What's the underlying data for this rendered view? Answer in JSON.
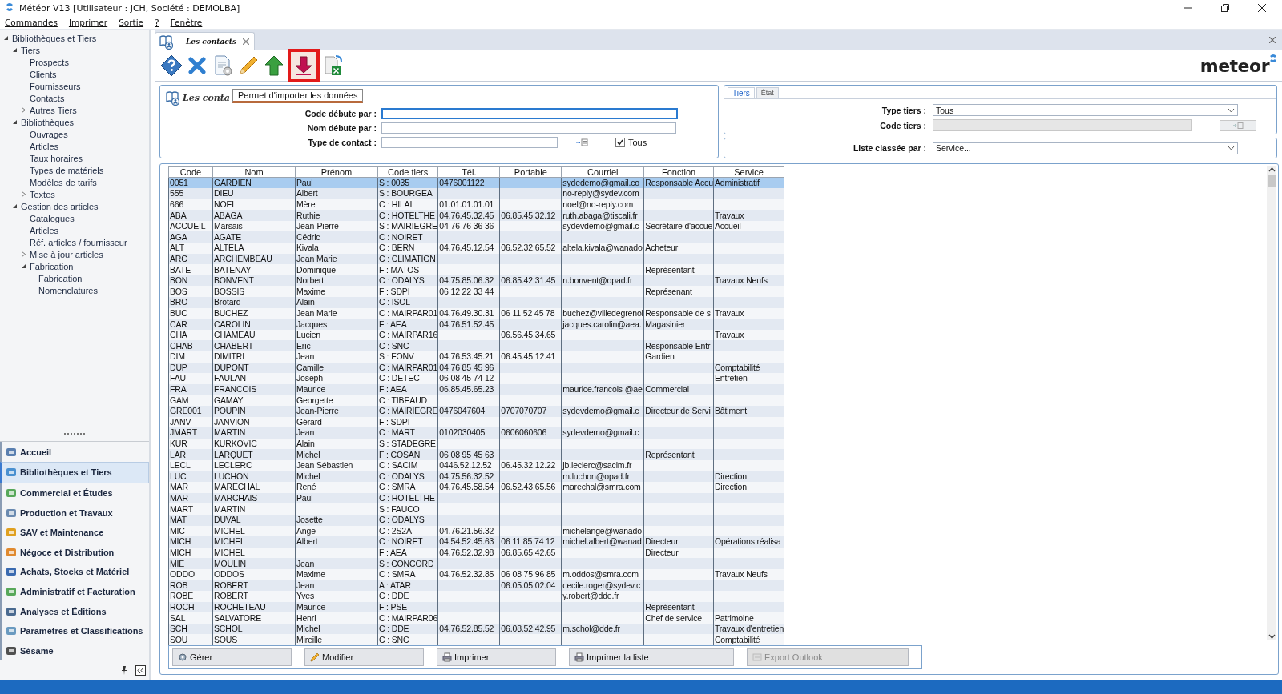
{
  "window": {
    "title": "Météor V13 [Utilisateur : JCH, Société : DEMOLBA]"
  },
  "menu": [
    "Commandes",
    "Imprimer",
    "Sortie",
    "?",
    "Fenêtre"
  ],
  "sidebar": {
    "tree": [
      {
        "label": "Bibliothèques et Tiers",
        "expanded": true,
        "children": [
          {
            "label": "Tiers",
            "expanded": true,
            "children": [
              {
                "label": "Prospects"
              },
              {
                "label": "Clients"
              },
              {
                "label": "Fournisseurs"
              },
              {
                "label": "Contacts"
              },
              {
                "label": "Autres Tiers",
                "expanded": false
              }
            ]
          },
          {
            "label": "Bibliothèques",
            "expanded": true,
            "children": [
              {
                "label": "Ouvrages"
              },
              {
                "label": "Articles"
              },
              {
                "label": "Taux horaires"
              },
              {
                "label": "Types de matériels"
              },
              {
                "label": "Modèles de tarifs"
              },
              {
                "label": "Textes",
                "expanded": false
              }
            ]
          },
          {
            "label": "Gestion des articles",
            "expanded": true,
            "children": [
              {
                "label": "Catalogues"
              },
              {
                "label": "Articles"
              },
              {
                "label": "Réf. articles / fournisseur"
              },
              {
                "label": "Mise à jour articles",
                "expanded": false
              },
              {
                "label": "Fabrication",
                "expanded": true,
                "children": [
                  {
                    "label": "Fabrication"
                  },
                  {
                    "label": "Nomenclatures"
                  }
                ]
              }
            ]
          }
        ]
      }
    ],
    "modules": [
      {
        "label": "Accueil",
        "selected": false,
        "color": "#5a7fb0"
      },
      {
        "label": "Bibliothèques et Tiers",
        "selected": true,
        "color": "#4a90d0"
      },
      {
        "label": "Commercial et Études",
        "selected": false,
        "color": "#58a85a"
      },
      {
        "label": "Production et Travaux",
        "selected": false,
        "color": "#6a8ab0"
      },
      {
        "label": "SAV et Maintenance",
        "selected": false,
        "color": "#e0a020"
      },
      {
        "label": "Négoce et Distribution",
        "selected": false,
        "color": "#e08a30"
      },
      {
        "label": "Achats, Stocks et Matériel",
        "selected": false,
        "color": "#3a6ab0"
      },
      {
        "label": "Administratif et Facturation",
        "selected": false,
        "color": "#58a85a"
      },
      {
        "label": "Analyses et Éditions",
        "selected": false,
        "color": "#4a6a90"
      },
      {
        "label": "Paramètres et Classifications",
        "selected": false,
        "color": "#6a9ac0"
      },
      {
        "label": "Sésame",
        "selected": false,
        "color": "#505050"
      }
    ]
  },
  "tab": {
    "title": "Les contacts"
  },
  "toolbar": {
    "buttons": [
      {
        "kind": "help",
        "highlighted": false
      },
      {
        "kind": "delete",
        "highlighted": false
      },
      {
        "kind": "settings",
        "highlighted": false
      },
      {
        "kind": "edit",
        "highlighted": false
      },
      {
        "kind": "export",
        "highlighted": false
      },
      {
        "kind": "import",
        "highlighted": true
      },
      {
        "kind": "excel",
        "highlighted": false
      }
    ],
    "tooltip": "Permet d'importer les données"
  },
  "brand": "meteor",
  "filter": {
    "title": "Les conta",
    "fields": [
      {
        "label": "Code débute par :",
        "kind": "text",
        "focused": true
      },
      {
        "label": "Nom débute par :",
        "kind": "text",
        "focused": false
      },
      {
        "label": "Type de contact :",
        "kind": "picker",
        "focused": false,
        "checkbox": {
          "label": "Tous",
          "checked": true
        }
      }
    ]
  },
  "tiers_panel": {
    "tabs": [
      {
        "label": "Tiers",
        "selected": true
      },
      {
        "label": "État",
        "selected": false
      }
    ],
    "fields": [
      {
        "label": "Type tiers :",
        "kind": "select",
        "value": "Tous"
      },
      {
        "label": "Code tiers :",
        "kind": "lookup",
        "disabled": true
      }
    ]
  },
  "sort": {
    "label": "Liste classée par :",
    "value": "Service..."
  },
  "table": {
    "columns": [
      "Code",
      "Nom",
      "Prénom",
      "Code tiers",
      "Tél.",
      "Portable",
      "Courriel",
      "Fonction",
      "Service"
    ],
    "rows": [
      {
        "selected": true,
        "cells": {
          "code": "0051",
          "nom": "GARDIEN",
          "prenom": "Paul",
          "tiers": "S : 0035",
          "tel": "0476001122",
          "courriel": "sydedemo@gmail.co",
          "fonction": "Responsable Accu",
          "service": "Administratif"
        }
      },
      {
        "selected": false,
        "cells": {
          "code": "555",
          "nom": "DIEU",
          "prenom": "Albert",
          "tiers": "S : BOURGEA",
          "courriel": "no-reply@sydev.com"
        }
      },
      {
        "selected": false,
        "cells": {
          "code": "666",
          "nom": "NOEL",
          "prenom": "Mère",
          "tiers": "C : HILAI",
          "tel": "01.01.01.01.01",
          "courriel": "noel@no-reply.com"
        }
      },
      {
        "selected": false,
        "cells": {
          "code": "ABA",
          "nom": "ABAGA",
          "prenom": "Ruthie",
          "tiers": "C : HOTELTHE",
          "tel": "04.76.45.32.45",
          "portable": "06.85.45.32.12",
          "courriel": "ruth.abaga@tiscali.fr",
          "service": "Travaux"
        }
      },
      {
        "selected": false,
        "cells": {
          "code": "ACCUEIL",
          "nom": "Marsais",
          "prenom": "Jean-Pierre",
          "tiers": "S : MAIRIEGRE",
          "tel": "04 76 76 36 36",
          "courriel": "sydevdemo@gmail.c",
          "fonction": "Secrétaire d'accue",
          "service": "Accueil"
        }
      },
      {
        "selected": false,
        "cells": {
          "code": "AGA",
          "nom": "AGATE",
          "prenom": "Cédric",
          "tiers": "C : NOIRET"
        }
      },
      {
        "selected": false,
        "cells": {
          "code": "ALT",
          "nom": "ALTELA",
          "prenom": "Kivala",
          "tiers": "C : BERN",
          "tel": "04.76.45.12.54",
          "portable": "06.52.32.65.52",
          "courriel": "altela.kivala@wanado",
          "fonction": "Acheteur"
        }
      },
      {
        "selected": false,
        "cells": {
          "code": "ARC",
          "nom": "ARCHEMBEAU",
          "prenom": "Jean Marie",
          "tiers": "C : CLIMATIGN"
        }
      },
      {
        "selected": false,
        "cells": {
          "code": "BATE",
          "nom": "BATENAY",
          "prenom": "Dominique",
          "tiers": "F : MATOS",
          "fonction": "Représentant"
        }
      },
      {
        "selected": false,
        "cells": {
          "code": "BON",
          "nom": "BONVENT",
          "prenom": "Norbert",
          "tiers": "C : ODALYS",
          "tel": "04.75.85.06.32",
          "portable": "06.85.42.31.45",
          "courriel": "n.bonvent@opad.fr",
          "service": "Travaux Neufs"
        }
      },
      {
        "selected": false,
        "cells": {
          "code": "BOS",
          "nom": "BOSSIS",
          "prenom": "Maxime",
          "tiers": "F : SDPI",
          "tel": "06 12 22 33 44",
          "fonction": "Représenant"
        }
      },
      {
        "selected": false,
        "cells": {
          "code": "BRO",
          "nom": "Brotard",
          "prenom": "Alain",
          "tiers": "C : ISOL"
        }
      },
      {
        "selected": false,
        "cells": {
          "code": "BUC",
          "nom": "BUCHEZ",
          "prenom": "Jean Marie",
          "tiers": "C : MAIRPAR01",
          "tel": "04.76.49.30.31",
          "portable": "06 11 52 45 78",
          "courriel": "buchez@villedegrenol",
          "fonction": "Responsable de s",
          "service": "Travaux"
        }
      },
      {
        "selected": false,
        "cells": {
          "code": "CAR",
          "nom": "CAROLIN",
          "prenom": "Jacques",
          "tiers": "F : AEA",
          "tel": "04.76.51.52.45",
          "courriel": "jacques.carolin@aea.",
          "fonction": "Magasinier"
        }
      },
      {
        "selected": false,
        "cells": {
          "code": "CHA",
          "nom": "CHAMEAU",
          "prenom": "Lucien",
          "tiers": "C : MAIRPAR16",
          "portable": "06.56.45.34.65",
          "service": "Travaux"
        }
      },
      {
        "selected": false,
        "cells": {
          "code": "CHAB",
          "nom": "CHABERT",
          "prenom": "Eric",
          "tiers": "C : SNC",
          "fonction": "Responsable Entr"
        }
      },
      {
        "selected": false,
        "cells": {
          "code": "DIM",
          "nom": "DIMITRI",
          "prenom": "Jean",
          "tiers": "S : FONV",
          "tel": "04.76.53.45.21",
          "portable": "06.45.45.12.41",
          "fonction": "Gardien"
        }
      },
      {
        "selected": false,
        "cells": {
          "code": "DUP",
          "nom": "DUPONT",
          "prenom": "Camille",
          "tiers": "C : MAIRPAR01",
          "tel": "04 76 85 45 96",
          "service": "Comptabilité"
        }
      },
      {
        "selected": false,
        "cells": {
          "code": "FAU",
          "nom": "FAULAN",
          "prenom": "Joseph",
          "tiers": "C : DETEC",
          "tel": "06 08 45 74 12",
          "service": "Entretien"
        }
      },
      {
        "selected": false,
        "cells": {
          "code": "FRA",
          "nom": "FRANCOIS",
          "prenom": "Maurice",
          "tiers": "F : AEA",
          "tel": "06.85.45.65.23",
          "courriel": "maurice.francois @ae",
          "fonction": "Commercial"
        }
      },
      {
        "selected": false,
        "cells": {
          "code": "GAM",
          "nom": "GAMAY",
          "prenom": "Georgette",
          "tiers": "C : TIBEAUD"
        }
      },
      {
        "selected": false,
        "cells": {
          "code": "GRE001",
          "nom": "POUPIN",
          "prenom": "Jean-Pierre",
          "tiers": "C : MAIRIEGRE",
          "tel": "0476047604",
          "portable": "0707070707",
          "courriel": "sydevdemo@gmail.c",
          "fonction": "Directeur de Servi",
          "service": "Bâtiment"
        }
      },
      {
        "selected": false,
        "cells": {
          "code": "JANV",
          "nom": "JANVION",
          "prenom": "Gérard",
          "tiers": "F : SDPI"
        }
      },
      {
        "selected": false,
        "cells": {
          "code": "JMART",
          "nom": "MARTIN",
          "prenom": "Jean",
          "tiers": "C : MART",
          "tel": "0102030405",
          "portable": "0606060606",
          "courriel": "sydevdemo@gmail.c"
        }
      },
      {
        "selected": false,
        "cells": {
          "code": "KUR",
          "nom": "KURKOVIC",
          "prenom": "Alain",
          "tiers": "S : STADEGRE"
        }
      },
      {
        "selected": false,
        "cells": {
          "code": "LAR",
          "nom": "LARQUET",
          "prenom": "Michel",
          "tiers": "F : COSAN",
          "tel": "06 08 95 45 63",
          "fonction": "Représentant"
        }
      },
      {
        "selected": false,
        "cells": {
          "code": "LECL",
          "nom": "LECLERC",
          "prenom": "Jean Sébastien",
          "tiers": "C : SACIM",
          "tel": "0446.52.12.52",
          "portable": "06.45.32.12.22",
          "courriel": "jb.leclerc@sacim.fr"
        }
      },
      {
        "selected": false,
        "cells": {
          "code": "LUC",
          "nom": "LUCHON",
          "prenom": "Michel",
          "tiers": "C : ODALYS",
          "tel": "04.75.56.32.52",
          "courriel": "m.luchon@opad.fr",
          "service": "Direction"
        }
      },
      {
        "selected": false,
        "cells": {
          "code": "MAR",
          "nom": "MARECHAL",
          "prenom": "René",
          "tiers": "C : SMRA",
          "tel": "04.76.45.58.54",
          "portable": "06.52.43.65.56",
          "courriel": "marechal@smra.com",
          "service": "Direction"
        }
      },
      {
        "selected": false,
        "cells": {
          "code": "MAR",
          "nom": "MARCHAIS",
          "prenom": "Paul",
          "tiers": "C : HOTELTHE"
        }
      },
      {
        "selected": false,
        "cells": {
          "code": "MART",
          "nom": "MARTIN",
          "tiers": "S : FAUCO"
        }
      },
      {
        "selected": false,
        "cells": {
          "code": "MAT",
          "nom": "DUVAL",
          "prenom": "Josette",
          "tiers": "C : ODALYS"
        }
      },
      {
        "selected": false,
        "cells": {
          "code": "MIC",
          "nom": "MICHEL",
          "prenom": "Ange",
          "tiers": "C : 2S2A",
          "tel": "04.76.21.56.32",
          "courriel": "michelange@wanado"
        }
      },
      {
        "selected": false,
        "cells": {
          "code": "MICH",
          "nom": "MICHEL",
          "prenom": "Albert",
          "tiers": "C : NOIRET",
          "tel": "04.54.52.45.63",
          "portable": "06 11 85 74 12",
          "courriel": "michel.albert@wanad",
          "fonction": "Directeur",
          "service": "Opérations réalisa"
        }
      },
      {
        "selected": false,
        "cells": {
          "code": "MICH",
          "nom": "MICHEL",
          "tiers": "F : AEA",
          "tel": "04.76.52.32.98",
          "portable": "06.85.65.42.65",
          "fonction": "Directeur"
        }
      },
      {
        "selected": false,
        "cells": {
          "code": "MIE",
          "nom": "MOULIN",
          "prenom": "Jean",
          "tiers": "S : CONCORD"
        }
      },
      {
        "selected": false,
        "cells": {
          "code": "ODDO",
          "nom": "ODDOS",
          "prenom": "Maxime",
          "tiers": "C : SMRA",
          "tel": "04.76.52.32.85",
          "portable": "06 08 75 96 85",
          "courriel": "m.oddos@smra.com",
          "service": "Travaux Neufs"
        }
      },
      {
        "selected": false,
        "cells": {
          "code": "ROB",
          "nom": "ROBERT",
          "prenom": "Jean",
          "tiers": "A : ATAR",
          "portable": "06.05.05.02.04",
          "courriel": "cecile.roger@sydev.c"
        }
      },
      {
        "selected": false,
        "cells": {
          "code": "ROBE",
          "nom": "ROBERT",
          "prenom": "Yves",
          "tiers": "C : DDE",
          "courriel": "y.robert@dde.fr"
        }
      },
      {
        "selected": false,
        "cells": {
          "code": "ROCH",
          "nom": "ROCHETEAU",
          "prenom": "Maurice",
          "tiers": "F : PSE",
          "fonction": "Représentant"
        }
      },
      {
        "selected": false,
        "cells": {
          "code": "SAL",
          "nom": "SALVATORE",
          "prenom": "Henri",
          "tiers": "C : MAIRPAR06",
          "fonction": "Chef de service",
          "service": "Patrimoine"
        }
      },
      {
        "selected": false,
        "cells": {
          "code": "SCH",
          "nom": "SCHOL",
          "prenom": "Michel",
          "tiers": "C : DDE",
          "tel": "04.76.52.85.52",
          "portable": "06.08.52.42.95",
          "courriel": "m.schol@dde.fr",
          "service": "Travaux d'entretien"
        }
      },
      {
        "selected": false,
        "cells": {
          "code": "SOU",
          "nom": "SOUS",
          "prenom": "Mireille",
          "tiers": "C : SNC",
          "service": "Comptabilité"
        }
      }
    ]
  },
  "actions": [
    {
      "label": "Gérer",
      "kind": "manage",
      "disabled": false
    },
    {
      "label": "Modifier",
      "kind": "edit",
      "disabled": false
    },
    {
      "label": "Imprimer",
      "kind": "print",
      "disabled": false
    },
    {
      "label": "Imprimer la liste",
      "kind": "print",
      "disabled": false
    },
    {
      "label": "Export Outlook",
      "kind": "export",
      "disabled": true
    }
  ]
}
